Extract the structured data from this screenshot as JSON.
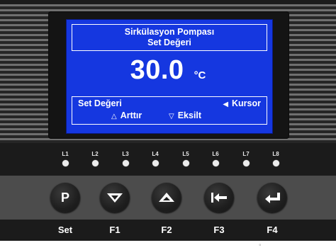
{
  "display": {
    "title_line1": "Sirkülasyon Pompası",
    "title_line2": "Set Değeri",
    "value": "30.0",
    "unit": "°C",
    "footer_label": "Set Değeri",
    "cursor_label": "Kursor",
    "increase_label": "Arttır",
    "decrease_label": "Eksilt"
  },
  "leds": [
    {
      "label": "L1"
    },
    {
      "label": "L2"
    },
    {
      "label": "L3"
    },
    {
      "label": "L4"
    },
    {
      "label": "L5"
    },
    {
      "label": "L6"
    },
    {
      "label": "L7"
    },
    {
      "label": "L8"
    }
  ],
  "buttons": [
    {
      "glyph": "P",
      "label": "Set",
      "icon": "p-letter"
    },
    {
      "label": "F1",
      "icon": "down-triangle-icon"
    },
    {
      "label": "F2",
      "icon": "up-triangle-icon"
    },
    {
      "label": "F3",
      "icon": "arrow-left-bar-icon"
    },
    {
      "label": "F4",
      "icon": "enter-return-icon"
    }
  ],
  "colors": {
    "lcd_background": "#1537e0",
    "lcd_text": "#ffffff",
    "panel": "#1b1b1b",
    "button_strip": "#4c4c4c"
  }
}
